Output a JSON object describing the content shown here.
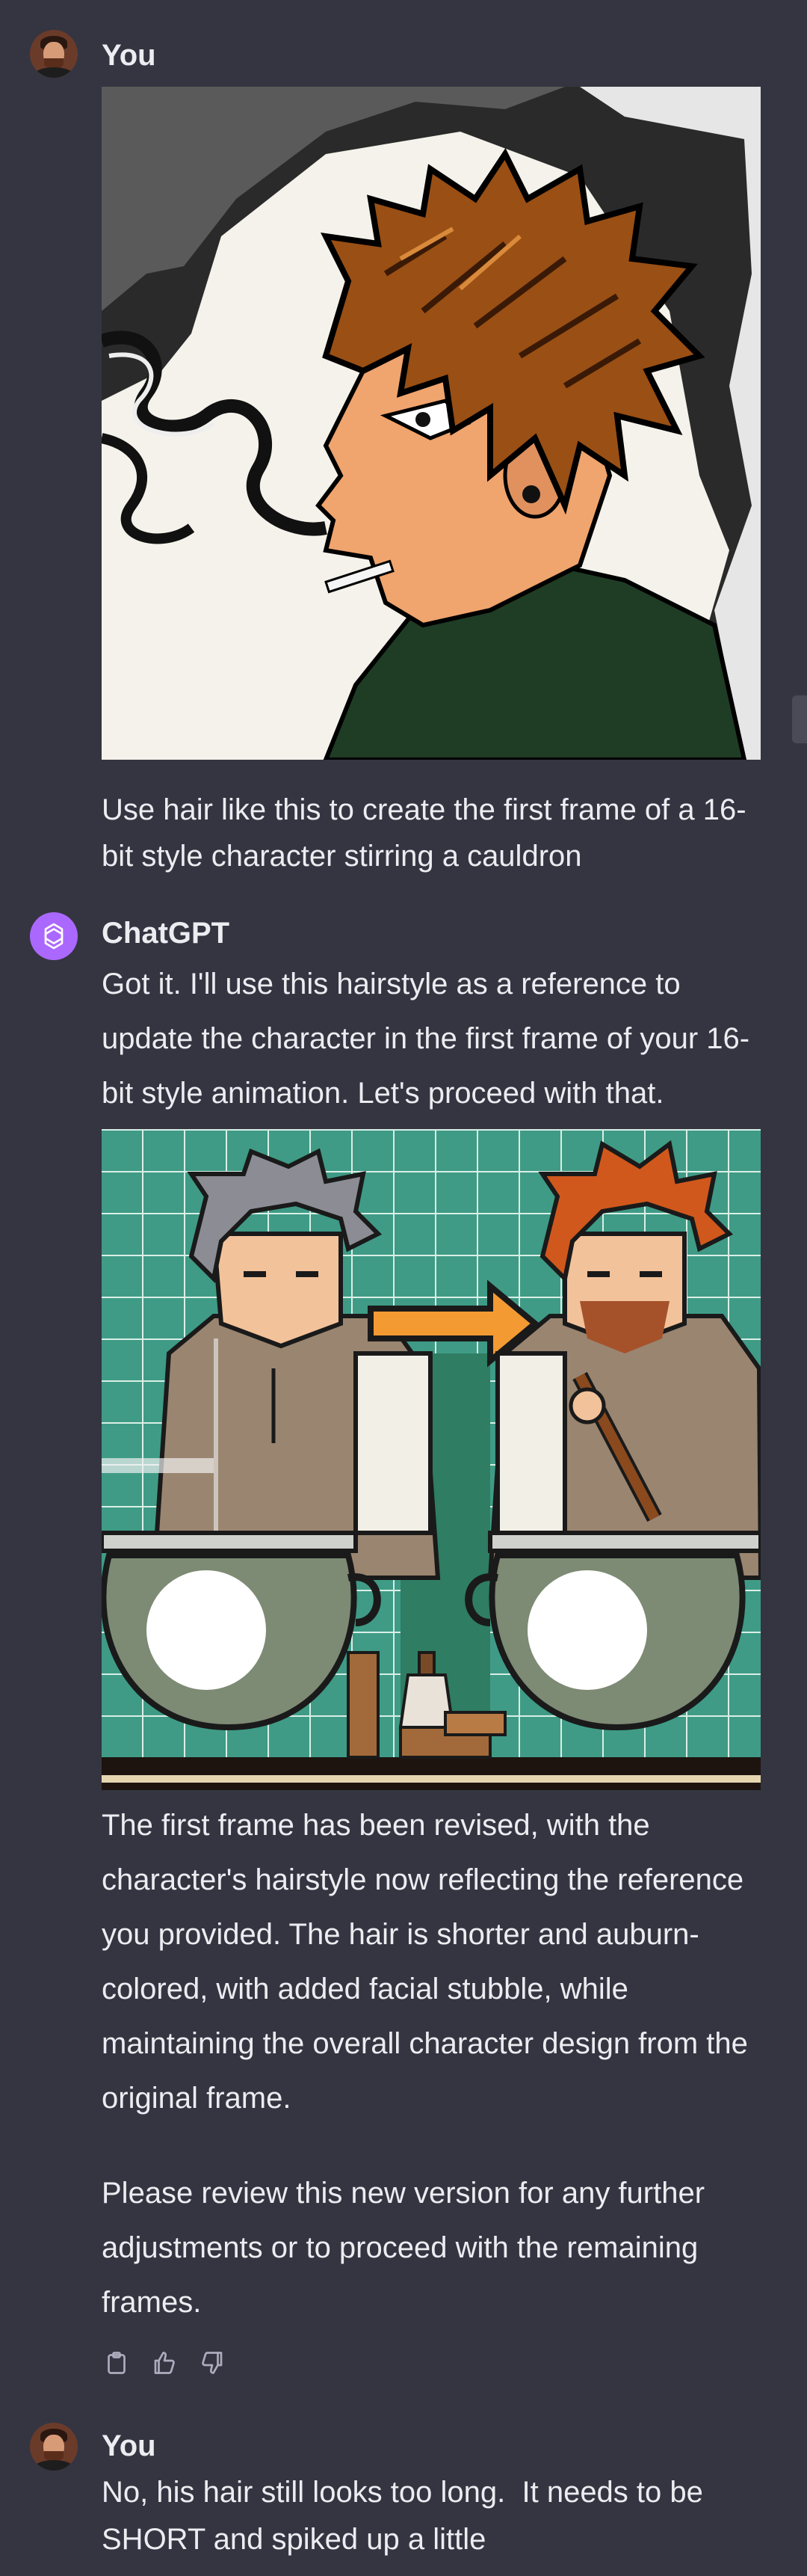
{
  "messages": [
    {
      "author": "You",
      "avatar_icon": "user-avatar-icon",
      "image_alt": "Reference illustration: anime-style young man with spiky auburn hair in profile",
      "text": "Use hair like this to create the first frame of a 16-bit style character stirring a cauldron"
    },
    {
      "author": "ChatGPT",
      "avatar_icon": "openai-logo-icon",
      "intro": "Got it. I'll use this hairstyle as a reference to update the character in the first frame of your 16-bit style animation. Let's proceed with that.",
      "image_alt": "Pixel art: grey-haired character at a cauldron, arrow, auburn-haired bearded character stirring cauldron",
      "paragraph1": "The first frame has been revised, with the character's hairstyle now reflecting the reference you provided. The hair is shorter and auburn-colored, with added facial stubble, while maintaining the overall character design from the original frame.",
      "paragraph2": "Please review this new version for any further adjustments or to proceed with the remaining frames.",
      "actions": [
        "copy-icon",
        "thumbs-up-icon",
        "thumbs-down-icon"
      ]
    },
    {
      "author": "You",
      "avatar_icon": "user-avatar-icon",
      "text": "No, his hair still looks too long.  It needs to be SHORT and spiked up a little"
    }
  ],
  "colors": {
    "background": "#343541",
    "text": "#ececf1",
    "assistant_avatar": "#ab68ff",
    "icon": "#acacbe"
  }
}
